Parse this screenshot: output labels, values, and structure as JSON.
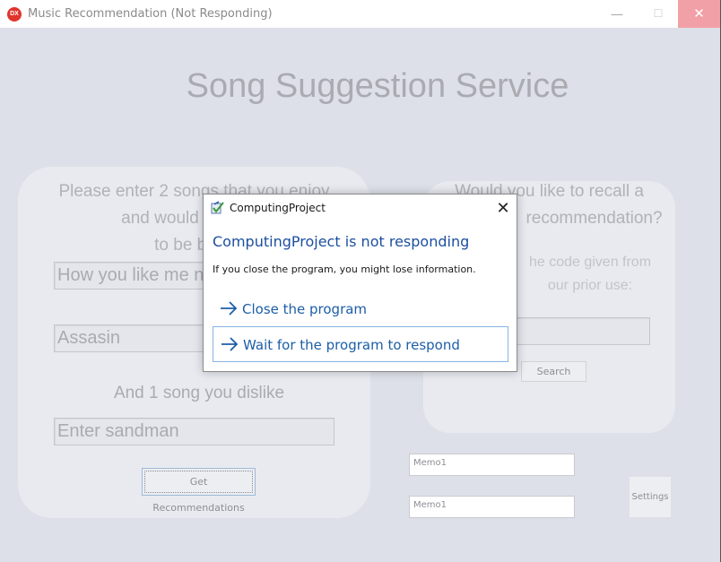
{
  "window": {
    "title": "Music Recommendation (Not Responding)",
    "icon_text": "DX",
    "minimize_glyph": "—",
    "maximize_glyph": "☐",
    "close_glyph": "✕"
  },
  "app": {
    "heading": "Song Suggestion Service",
    "left_prompt_line1": "Please enter 2 songs that you enjoy",
    "left_prompt_line2": "and would like your",
    "left_prompt_line3": "to be base",
    "song1_value": "How you like me n",
    "song2_value": "Assasin",
    "dislike_label": "And 1 song you dislike",
    "dislike_value": "Enter sandman",
    "get_button_label": "Get Recommendations",
    "right_prompt_line1": "Would you like to recall a",
    "right_prompt_line2": "recommendation?",
    "code_prompt_line1": "he code given from",
    "code_prompt_line2": "our prior use:",
    "code_value": "",
    "search_button_label": "Search",
    "memo1_text": "Memo1",
    "memo2_text": "Memo1",
    "settings_button_label": "Settings"
  },
  "dialog": {
    "title": "ComputingProject",
    "close_glyph": "✕",
    "heading": "ComputingProject is not responding",
    "message": "If you close the program, you might lose information.",
    "option_close_label": "Close the program",
    "option_wait_label": "Wait for the program to respond"
  },
  "colors": {
    "dialog_heading": "#1c4fa0",
    "dialog_link": "#1c5ea8",
    "close_hover": "#f0a0a6",
    "background": "#dde0e8"
  }
}
